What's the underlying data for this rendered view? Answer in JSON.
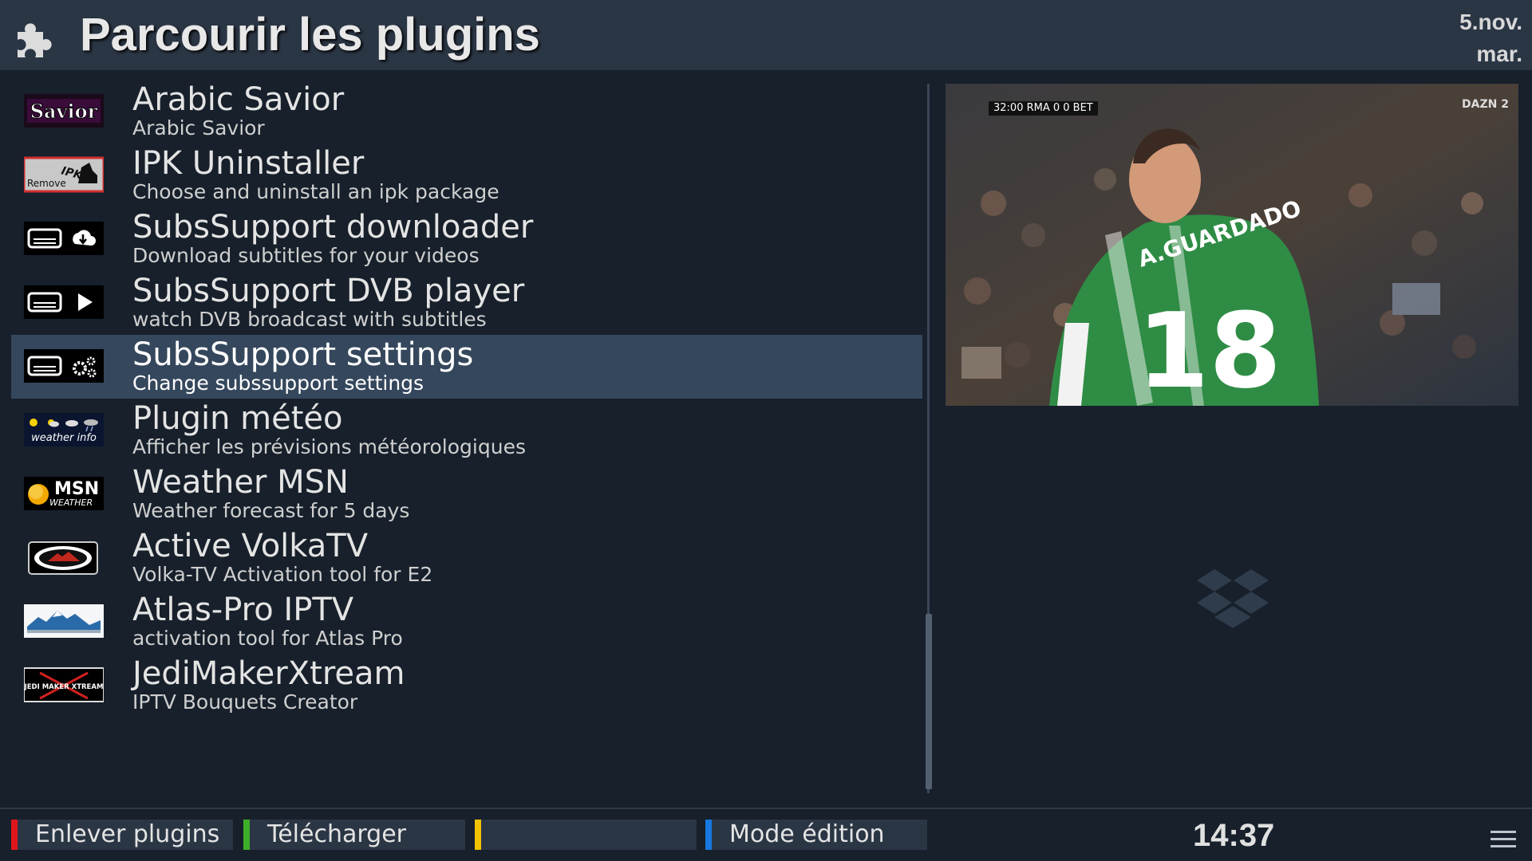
{
  "header": {
    "title": "Parcourir les plugins",
    "date_line1": "5.nov.",
    "date_line2": "mar."
  },
  "plugins": [
    {
      "title": "Arabic Savior",
      "subtitle": "Arabic Savior",
      "icon": "savior-logo",
      "icon_text": "Savior"
    },
    {
      "title": "IPK Uninstaller",
      "subtitle": "Choose and uninstall an ipk package",
      "icon": "ipk-remove-icon",
      "icon_text": "Remove"
    },
    {
      "title": "SubsSupport downloader",
      "subtitle": "Download subtitles for your videos",
      "icon": "subtitle-download-icon"
    },
    {
      "title": "SubsSupport DVB player",
      "subtitle": "watch DVB broadcast with subtitles",
      "icon": "subtitle-play-icon"
    },
    {
      "title": "SubsSupport settings",
      "subtitle": "Change subssupport settings",
      "icon": "subtitle-settings-icon",
      "selected": true
    },
    {
      "title": "Plugin météo",
      "subtitle": "Afficher les prévisions météorologiques",
      "icon": "weather-info-icon",
      "icon_text": "weather info"
    },
    {
      "title": "Weather MSN",
      "subtitle": "Weather forecast for 5 days",
      "icon": "msn-weather-icon",
      "icon_text": "MSN",
      "icon_text2": "WEATHER"
    },
    {
      "title": "Active VolkaTV",
      "subtitle": "Volka-TV Activation tool for E2",
      "icon": "volkatv-logo"
    },
    {
      "title": "Atlas-Pro IPTV",
      "subtitle": "activation tool for Atlas Pro",
      "icon": "atlas-pro-logo"
    },
    {
      "title": "JediMakerXtream",
      "subtitle": "IPTV Bouquets Creator",
      "icon": "jedimaker-logo",
      "icon_text": "JEDI MAKER XTREAM"
    }
  ],
  "preview": {
    "score": "32:00  RMA  0  0  BET",
    "channel": "DAZN 2",
    "jersey_name": "A.GUARDADO",
    "jersey_number": "18"
  },
  "footer": {
    "buttons": [
      {
        "label": "Enlever plugins",
        "color": "#e0161c"
      },
      {
        "label": "Télécharger",
        "color": "#3fae2a"
      },
      {
        "label": "",
        "color": "#f2c200"
      },
      {
        "label": "Mode édition",
        "color": "#1778e0"
      }
    ],
    "clock": "14:37"
  },
  "colors": {
    "background": "#17202b",
    "header": "#2b3645",
    "selection": "#35475c"
  }
}
